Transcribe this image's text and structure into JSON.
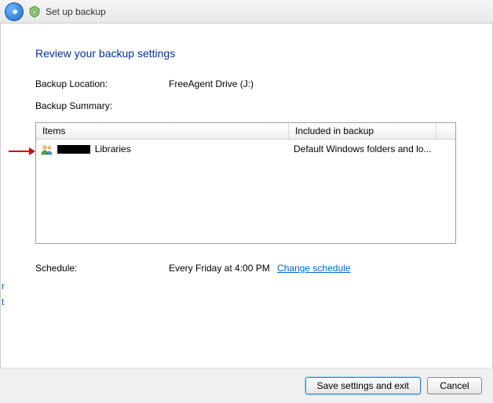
{
  "titlebar": {
    "title": "Set up backup"
  },
  "page": {
    "heading": "Review your backup settings",
    "backup_location_label": "Backup Location:",
    "backup_location_value": "FreeAgent Drive (J:)",
    "backup_summary_label": "Backup Summary:"
  },
  "table": {
    "header_items": "Items",
    "header_included": "Included in backup",
    "rows": [
      {
        "item_suffix": "Libraries",
        "included": "Default Windows folders and lo..."
      }
    ]
  },
  "schedule": {
    "label": "Schedule:",
    "value": "Every Friday at 4:00 PM",
    "change_link": "Change schedule"
  },
  "buttons": {
    "save": "Save settings and exit",
    "cancel": "Cancel"
  },
  "fragments": {
    "a": "r",
    "b": "t"
  }
}
